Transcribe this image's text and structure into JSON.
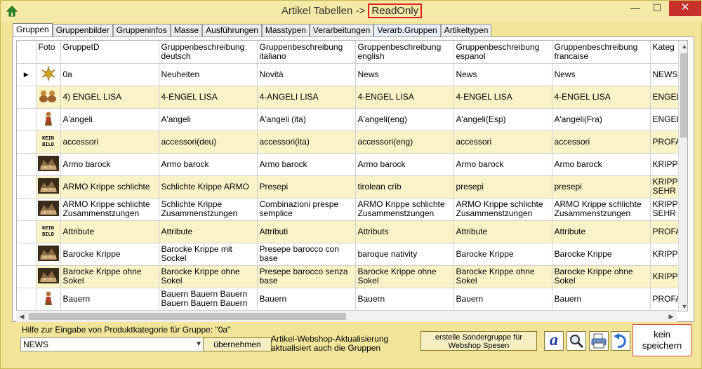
{
  "window": {
    "title_prefix": "Artikel Tabellen ->",
    "title_mode": "ReadOnly",
    "minimize": "—",
    "maximize": "☐",
    "close": "✕"
  },
  "tabs": [
    "Gruppen",
    "Gruppenbilder",
    "Gruppeninfos",
    "Masse",
    "Ausführungen",
    "Masstypen",
    "Verarbeitungen",
    "Verarb.Gruppen",
    "Artikeltypen"
  ],
  "table": {
    "headers": [
      "Foto",
      "GruppeID",
      "Gruppenbeschreibung deutsch",
      "Gruppenbeschreibung italiano",
      "Gruppenbeschreibung english",
      "Gruppenbeschreibung espanol",
      "Gruppenbeschreibung francaise",
      "Kateg"
    ],
    "rows": [
      {
        "foto": "star",
        "cells": [
          "0a",
          "Neuheiten",
          "Novità",
          "News",
          "News",
          "News",
          "NEWS"
        ]
      },
      {
        "foto": "angels",
        "cells": [
          "4)    ENGEL LISA",
          "4-ENGEL LISA",
          "4-ANGELI LISA",
          "4-ENGEL LISA",
          "4-ENGEL LISA",
          "4-ENGEL LISA",
          "ENGEL"
        ]
      },
      {
        "foto": "figure",
        "cells": [
          "A'angeli",
          "A'angeli",
          "A'angeli (ita)",
          "A'angeli(eng)",
          "A'angeli(Esp)",
          "A'angeli(Fra)",
          "ENGEL"
        ]
      },
      {
        "foto": "kein",
        "cells": [
          "accessori",
          "accessori(deu)",
          "accessori(ita)",
          "accessori(eng)",
          "accessori",
          "accessori",
          "PROFA"
        ]
      },
      {
        "foto": "crib",
        "cells": [
          "Armo barock",
          "Armo barock",
          "Armo barock",
          "Armo barock",
          "Armo barock",
          "Armo barock",
          "KRIPP"
        ]
      },
      {
        "foto": "crib",
        "cells": [
          "ARMO Krippe schlichte",
          "Schlichte Krippe ARMO",
          "Presepi",
          "tirolean crib",
          "presepi",
          "presepi",
          "KRIPP SEHR"
        ]
      },
      {
        "foto": "crib",
        "cells": [
          "ARMO Krippe schlichte Zusammenstzungen",
          "Schlichte Krippe Zusammenstzungen",
          "Combinazioni prespe semplice",
          "ARMO Krippe schlichte Zusammenstzungen",
          "ARMO Krippe schlichte Zusammenstzungen",
          "ARMO Krippe schlichte Zusammenstzungen",
          "KRIPP SEHR"
        ]
      },
      {
        "foto": "kein",
        "cells": [
          "Attribute",
          "Attribute",
          "Attributi",
          "Attributs",
          "Attribute",
          "Attribute",
          "PROFA"
        ]
      },
      {
        "foto": "crib",
        "cells": [
          "Barocke Krippe",
          "Barocke Krippe mit Sockel",
          "Presepe barocco con base",
          "baroque nativity",
          "Barocke Krippe",
          "Barocke Krippe",
          "KRIPP"
        ]
      },
      {
        "foto": "crib",
        "cells": [
          "Barocke Krippe ohne Sokel",
          "Barocke Krippe ohne Sokel",
          "Presepe barocco senza base",
          "Barocke Krippe ohne Sokel",
          "Barocke Krippe ohne Sokel",
          "Barocke Krippe ohne Sokel",
          "KRIPP"
        ]
      },
      {
        "foto": "figure",
        "cells": [
          "Bauern",
          "Bauern Bauern Bauern Bauern Bauern Bauern",
          "Bauern",
          "Bauern",
          "Bauern",
          "Bauern",
          "PROFA"
        ]
      }
    ],
    "kein_bild": "KEIN\nBILD"
  },
  "bottom": {
    "help_label": "Hilfe zur Eingabe von Produktkategorie für Gruppe:  \"0a\"",
    "select_value": "NEWS",
    "uebernehmen": "übernehmen",
    "info": "Artikel-Webshop-Aktualisierung aktualisiert auch die Gruppen",
    "sondergruppe": "erstelle Sondergruppe  für Webshop Spesen",
    "a_icon": "a",
    "kein_speichern": "kein speichern"
  }
}
